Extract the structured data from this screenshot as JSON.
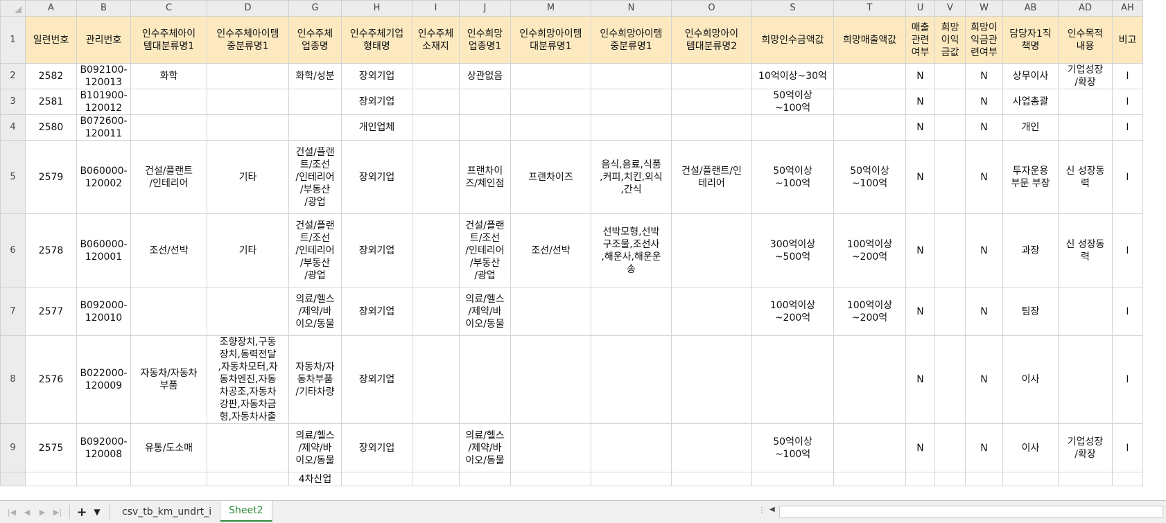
{
  "corner": "",
  "columns": [
    "A",
    "B",
    "C",
    "D",
    "G",
    "H",
    "I",
    "J",
    "M",
    "N",
    "O",
    "S",
    "T",
    "U",
    "V",
    "W",
    "AB",
    "AD",
    "AH"
  ],
  "header_row": {
    "num": "1",
    "cells": [
      "일련번호",
      "관리번호",
      "인수주체아이\n템대분류명1",
      "인수주체아이템\n중분류명1",
      "인수주체\n업종명",
      "인수주체기업\n형태명",
      "인수주체\n소재지",
      "인수희망\n업종명1",
      "인수희망아이템\n대분류명1",
      "인수희망아이템\n중분류명1",
      "인수희망아이\n템대분류명2",
      "희망인수금액값",
      "희망매출액값",
      "매출\n관련\n여부",
      "희망\n이익\n금값",
      "희망이\n익금관\n련여부",
      "담당자1직\n책명",
      "인수목적\n내용",
      "비고"
    ]
  },
  "rows": [
    {
      "num": "2",
      "cells": [
        "2582",
        "B092100-\n120013",
        "화학",
        "",
        "화학/성분",
        "장외기업",
        "",
        "상관없음",
        "",
        "",
        "",
        "10억이상~30억",
        "",
        "N",
        "",
        "N",
        "상무이사",
        "기업성장\n/확장",
        "I"
      ]
    },
    {
      "num": "3",
      "cells": [
        "2581",
        "B101900-\n120012",
        "",
        "",
        "",
        "장외기업",
        "",
        "",
        "",
        "",
        "",
        "50억이상\n~100억",
        "",
        "N",
        "",
        "N",
        "사업총괄",
        "",
        "I"
      ]
    },
    {
      "num": "4",
      "cells": [
        "2580",
        "B072600-\n120011",
        "",
        "",
        "",
        "개인업체",
        "",
        "",
        "",
        "",
        "",
        "",
        "",
        "N",
        "",
        "N",
        "개인",
        "",
        "I"
      ]
    },
    {
      "num": "5",
      "cells": [
        "2579",
        "B060000-\n120002",
        "건설/플랜트\n/인테리어",
        "기타",
        "건설/플랜\n트/조선\n/인테리어\n/부동산\n/광업",
        "장외기업",
        "",
        "프랜차이\n즈/체인점",
        "프랜차이즈",
        "음식,음료,식품\n,커피,치킨,외식\n,간식",
        "건설/플랜트/인\n테리어",
        "50억이상\n~100억",
        "50억이상\n~100억",
        "N",
        "",
        "N",
        "투자운용\n부문 부장",
        "신 성장동\n력",
        "I"
      ]
    },
    {
      "num": "6",
      "cells": [
        "2578",
        "B060000-\n120001",
        "조선/선박",
        "기타",
        "건설/플랜\n트/조선\n/인테리어\n/부동산\n/광업",
        "장외기업",
        "",
        "건설/플랜\n트/조선\n/인테리어\n/부동산\n/광업",
        "조선/선박",
        "선박모형,선박\n구조물,조선사\n,해운사,해운운\n송",
        "",
        "300억이상\n~500억",
        "100억이상\n~200억",
        "N",
        "",
        "N",
        "과장",
        "신 성장동\n력",
        "I"
      ]
    },
    {
      "num": "7",
      "cells": [
        "2577",
        "B092000-\n120010",
        "",
        "",
        "의료/헬스\n/제약/바\n이오/동물",
        "장외기업",
        "",
        "의료/헬스\n/제약/바\n이오/동물",
        "",
        "",
        "",
        "100억이상\n~200억",
        "100억이상\n~200억",
        "N",
        "",
        "N",
        "팀장",
        "",
        "I"
      ]
    },
    {
      "num": "8",
      "cells": [
        "2576",
        "B022000-\n120009",
        "자동차/자동차\n부품",
        "조향장치,구동\n장치,동력전달\n,자동차모터,자\n동차엔진,자동\n차공조,자동차\n강판,자동차금\n형,자동차사출",
        "자동차/자\n동차부품\n/기타차량",
        "장외기업",
        "",
        "",
        "",
        "",
        "",
        "",
        "",
        "N",
        "",
        "N",
        "이사",
        "",
        "I"
      ]
    },
    {
      "num": "9",
      "cells": [
        "2575",
        "B092000-\n120008",
        "유통/도소매",
        "",
        "의료/헬스\n/제약/바\n이오/동물",
        "장외기업",
        "",
        "의료/헬스\n/제약/바\n이오/동물",
        "",
        "",
        "",
        "50억이상\n~100억",
        "",
        "N",
        "",
        "N",
        "이사",
        "기업성장\n/확장",
        "I"
      ]
    },
    {
      "num": "",
      "cells": [
        "",
        "",
        "",
        "",
        "4차산업",
        "",
        "",
        "",
        "",
        "",
        "",
        "",
        "",
        "",
        "",
        "",
        "",
        "",
        ""
      ]
    }
  ],
  "tabs": {
    "add": "+",
    "list": "▼",
    "sheet1": "csv_tb_km_undrt_i",
    "sheet2": "Sheet2"
  },
  "icons": {
    "first": "first-sheet-icon",
    "prev": "prev-sheet-icon",
    "next": "next-sheet-icon",
    "last": "last-sheet-icon"
  }
}
